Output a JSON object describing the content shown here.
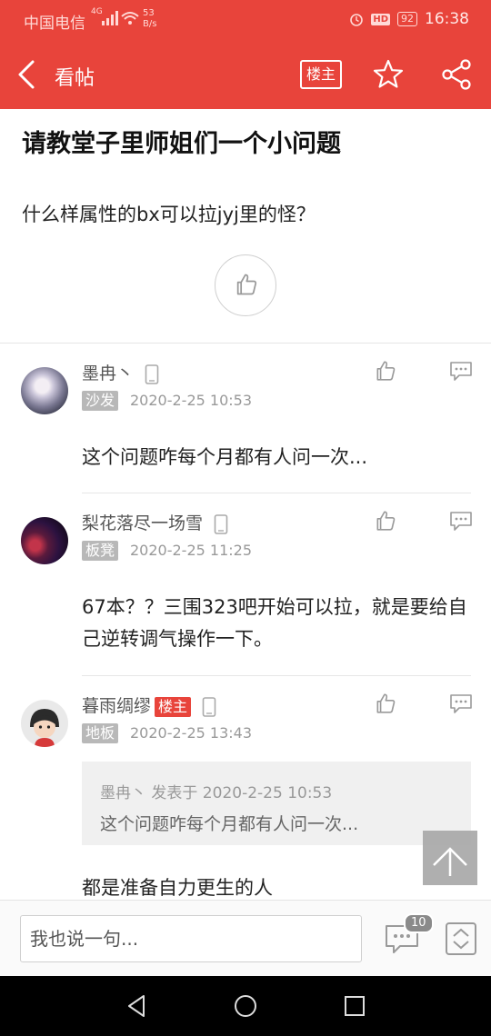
{
  "status_bar": {
    "carrier": "中国电信",
    "network": "4G",
    "speed_value": "53",
    "speed_unit": "B/s",
    "hd_badge": "HD",
    "battery": "92",
    "time": "16:38"
  },
  "header": {
    "title": "看帖",
    "louzhu_label": "楼主",
    "back_icon": "chevron-left-icon",
    "star_icon": "star-icon",
    "share_icon": "share-icon"
  },
  "post": {
    "title": "请教堂子里师姐们一个小问题",
    "body": "什么样属性的bx可以拉jyj里的怪？"
  },
  "replies": [
    {
      "username": "墨冉丶",
      "floor": "沙发",
      "date": "2020-2-25 10:53",
      "text": "这个问题咋每个月都有人问一次..."
    },
    {
      "username": "梨花落尽一场雪",
      "floor": "板凳",
      "date": "2020-2-25 11:25",
      "text": "67本？？三围323吧开始可以拉，就是要给自己逆转调气操作一下。"
    },
    {
      "username": "暮雨绸缪",
      "badge": "楼主",
      "floor": "地板",
      "date": "2020-2-25 13:43",
      "quote_header": "墨冉丶 发表于 2020-2-25 10:53",
      "quote_text": "这个问题咋每个月都有人问一次...",
      "text": "都是准备自力更生的人"
    }
  ],
  "bottom_bar": {
    "input_placeholder": "我也说一句...",
    "comment_count": "10"
  },
  "colors": {
    "brand_red": "#e8443b",
    "floor_badge_gray": "#b8b8b8"
  }
}
